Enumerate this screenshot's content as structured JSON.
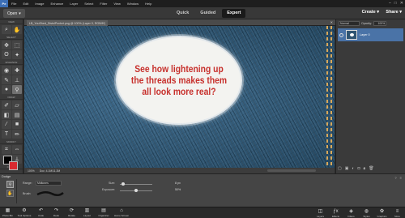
{
  "app": {
    "logo": "Pe"
  },
  "menubar": {
    "items": [
      "File",
      "Edit",
      "Image",
      "Enhance",
      "Layer",
      "Select",
      "Filter",
      "View",
      "Window",
      "Help"
    ]
  },
  "modebar": {
    "open_label": "Open",
    "tabs": [
      "Quick",
      "Guided",
      "Expert"
    ],
    "active_tab": "Expert",
    "create_label": "Create",
    "share_label": "Share"
  },
  "toolbox": {
    "sections": [
      "VIEW",
      "SELECT",
      "ENHANCE",
      "DRAW",
      "MODIFY",
      "COLOR"
    ],
    "colors": {
      "foreground": "#000000",
      "background": "#d92a30"
    }
  },
  "document": {
    "tab_title": "LB_YouShed_DistolPocket.png @ 100% (Layer 0, RGB/8*)",
    "status_zoom": "100%",
    "status_info": "Doc: 4.1M/11.3M",
    "overlay_text": "See how lightening up the threads makes them all look more real?"
  },
  "layers_panel": {
    "blend_mode": "Normal",
    "opacity_label": "Opacity:",
    "opacity_value": "100%",
    "layer_name": "Layer 0"
  },
  "tool_options": {
    "tool_name": "Dodge",
    "range_label": "Range:",
    "range_value": "Midtones",
    "brush_label": "Brush:",
    "size_label": "Size:",
    "size_value": "8 px",
    "exposure_label": "Exposure:",
    "exposure_value": "50%"
  },
  "taskbar": {
    "left": [
      "Photo Bin",
      "Tool Options",
      "Undo",
      "Redo",
      "Rotate",
      "Layout",
      "Organizer",
      "Home Screen"
    ],
    "right": [
      "Layers",
      "Effects",
      "Filters",
      "Styles",
      "Graphics",
      "More"
    ]
  }
}
